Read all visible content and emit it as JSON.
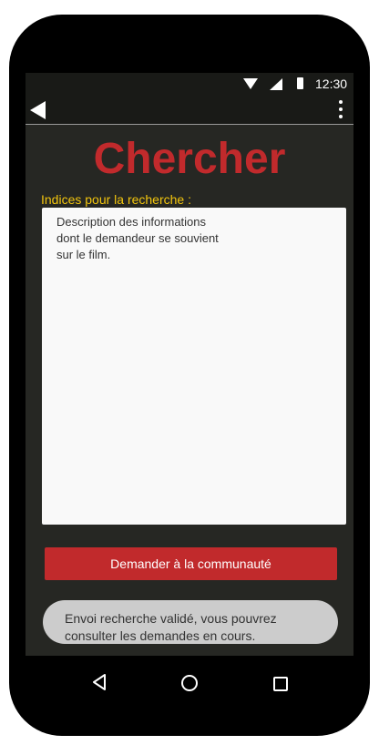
{
  "status_bar": {
    "time": "12:30",
    "icons": [
      "wifi-icon",
      "signal-icon",
      "battery-icon"
    ]
  },
  "app_bar": {
    "back_icon": "back-arrow-icon",
    "menu_icon": "more-vert-icon"
  },
  "page": {
    "title": "Chercher",
    "field_label": "Indices pour la recherche :",
    "textarea_lines": [
      "Description des informations",
      "dont le demandeur se souvient",
      "sur le film."
    ],
    "submit_label": "Demander à la communauté",
    "toast_lines": [
      "Envoi recherche validé, vous pouvrez",
      "consulter les demandes en cours."
    ]
  },
  "nav_bar": {
    "icons": [
      "nav-back-icon",
      "nav-home-icon",
      "nav-recent-icon"
    ]
  },
  "colors": {
    "accent": "#c12a2c",
    "label": "#f2c50e",
    "background": "#262723",
    "toast": "#cccccc"
  }
}
